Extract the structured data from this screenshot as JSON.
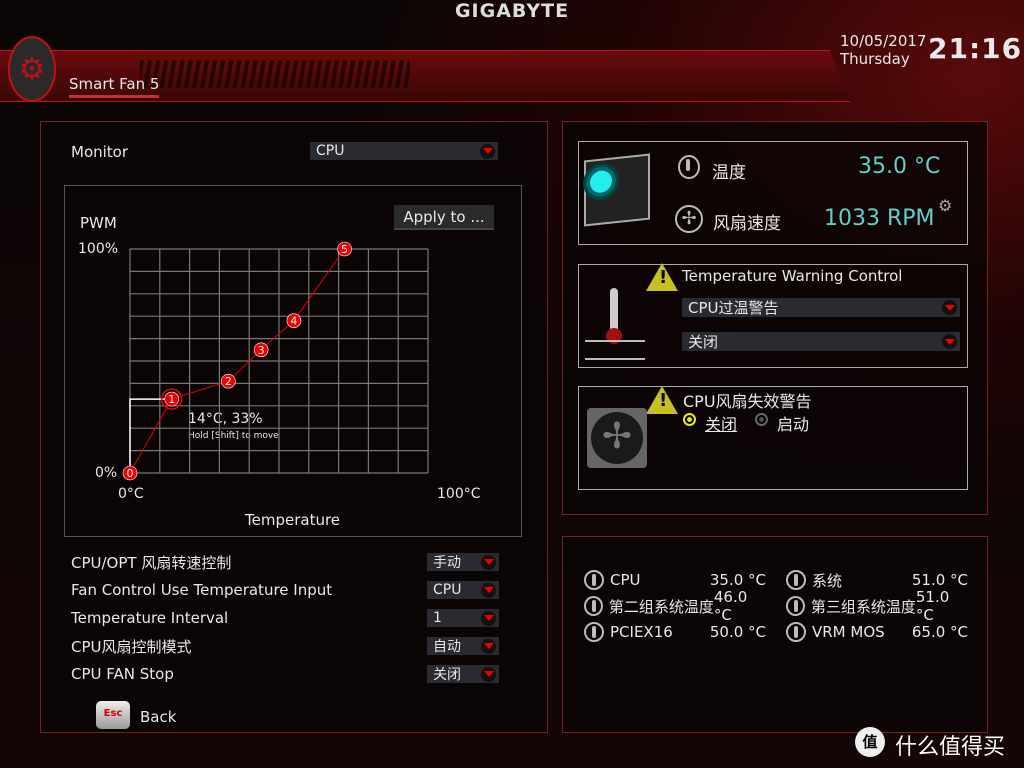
{
  "brand": "GIGABYTE",
  "header": {
    "title": "Smart Fan 5",
    "date": "10/05/2017",
    "weekday": "Thursday",
    "time": "21:16"
  },
  "left": {
    "monitor_label": "Monitor",
    "monitor_value": "CPU",
    "apply_button": "Apply to ...",
    "settings": [
      {
        "label": "CPU/OPT 风扇转速控制",
        "value": "手动"
      },
      {
        "label": "Fan Control Use Temperature Input",
        "value": "CPU"
      },
      {
        "label": "Temperature Interval",
        "value": "1"
      },
      {
        "label": "CPU风扇控制模式",
        "value": "自动"
      },
      {
        "label": "CPU FAN Stop",
        "value": "关闭"
      }
    ],
    "back": {
      "key": "Esc",
      "label": "Back"
    }
  },
  "chart_data": {
    "type": "line",
    "ylabel": "PWM",
    "xlabel": "Temperature",
    "xlim": [
      0,
      100
    ],
    "ylim": [
      0,
      100
    ],
    "grid": true,
    "xticks": [
      "0°C",
      "100°C"
    ],
    "yticks": [
      "0%",
      "100%"
    ],
    "points": [
      {
        "id": "0",
        "x": 0,
        "y": 0
      },
      {
        "id": "1",
        "x": 14,
        "y": 33
      },
      {
        "id": "2",
        "x": 33,
        "y": 41
      },
      {
        "id": "3",
        "x": 44,
        "y": 55
      },
      {
        "id": "4",
        "x": 55,
        "y": 68
      },
      {
        "id": "5",
        "x": 72,
        "y": 100
      }
    ],
    "selected_label": "14°C, 33%",
    "hint": "Hold [Shift] to move",
    "line_color": "#e00000"
  },
  "status": {
    "temp_label": "温度",
    "temp_value": "35.0 °C",
    "fan_label": "风扇速度",
    "fan_value": "1033 RPM",
    "value_color": "#5fd0c8"
  },
  "temp_warning": {
    "title": "Temperature Warning Control",
    "select1": "CPU过温警告",
    "select2": "关闭"
  },
  "fan_fail": {
    "title": "CPU风扇失效警告",
    "option_off": "关闭",
    "option_on": "启动",
    "selected": "关闭"
  },
  "temps": [
    {
      "name": "CPU",
      "value": "35.0 °C"
    },
    {
      "name": "系统",
      "value": "51.0 °C"
    },
    {
      "name": "第二组系统温度",
      "value": "46.0 °C"
    },
    {
      "name": "第三组系统温度",
      "value": "51.0 °C"
    },
    {
      "name": "PCIEX16",
      "value": "50.0 °C"
    },
    {
      "name": "VRM MOS",
      "value": "65.0 °C"
    }
  ],
  "watermark": "什么值得买"
}
